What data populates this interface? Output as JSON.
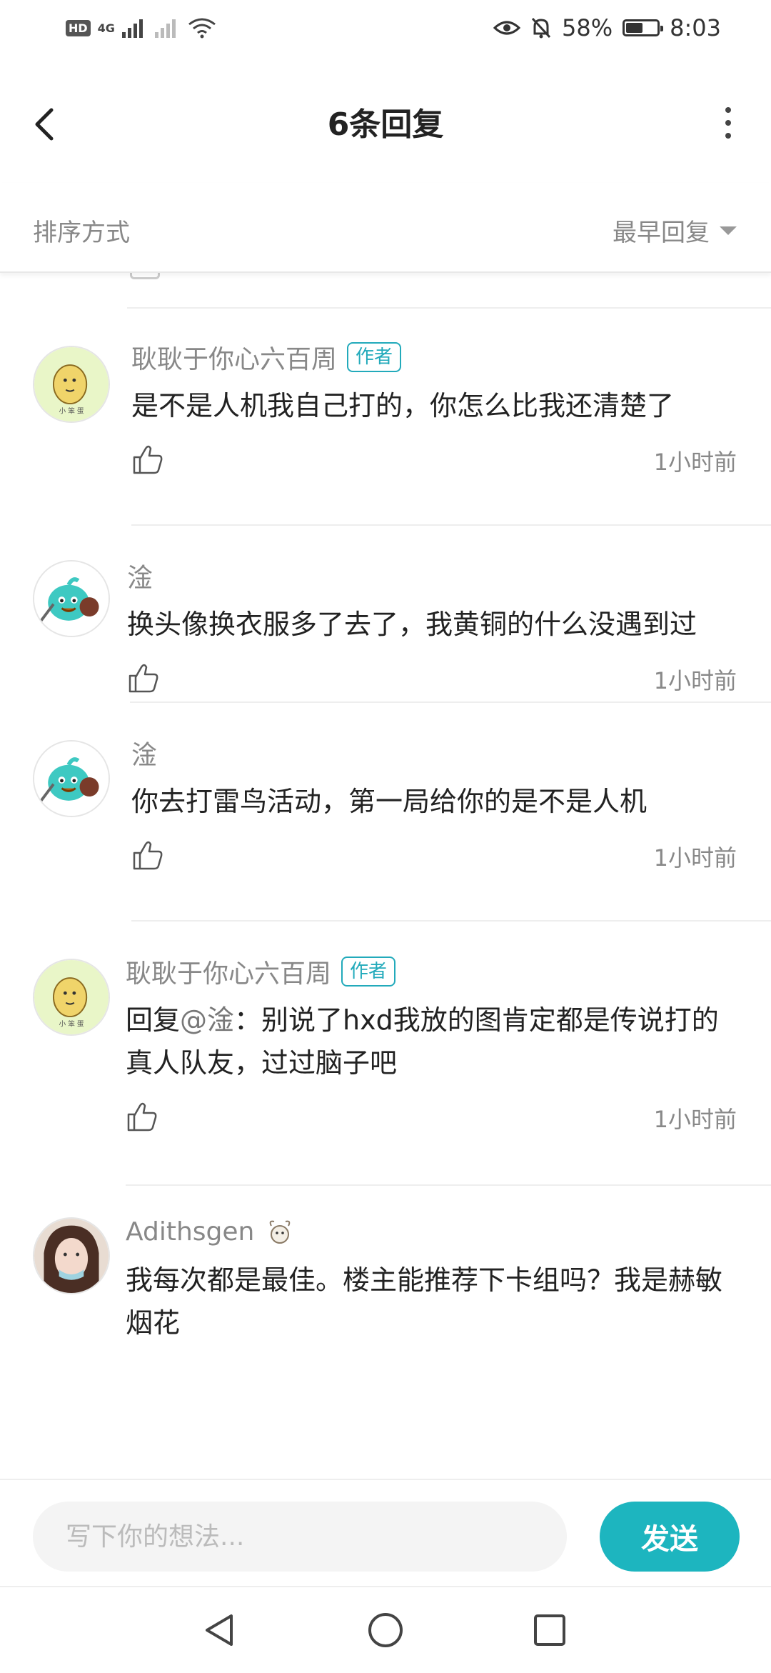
{
  "status_bar": {
    "left_badges": [
      "HD",
      "4G"
    ],
    "battery_text": "58%",
    "battery_level_percent": 58,
    "time": "8:03"
  },
  "header": {
    "title": "6条回复"
  },
  "sort": {
    "label": "排序方式",
    "selected": "最早回复"
  },
  "comments": [
    {
      "username": "耿耿于你心六百周",
      "badge": "作者",
      "text": "是不是人机我自己打的，你怎么比我还清楚了",
      "time": "1小时前",
      "avatar": "potato-avatar"
    },
    {
      "username": "淦",
      "text": "换头像换衣服多了去了，我黄铜的什么没遇到过",
      "time": "1小时前",
      "avatar": "cyan-creature-avatar"
    },
    {
      "username": "淦",
      "text": "你去打雷鸟活动，第一局给你的是不是人机",
      "time": "1小时前",
      "avatar": "cyan-creature-avatar"
    },
    {
      "username": "耿耿于你心六百周",
      "badge": "作者",
      "reply_prefix": "回复",
      "mention": "@淦",
      "text": "：别说了hxd我放的图肯定都是传说打的真人队友，过过脑子吧",
      "time": "1小时前",
      "avatar": "potato-avatar"
    },
    {
      "username": "Adithsgen",
      "text": "我每次都是最佳。楼主能推荐下卡组吗？我是赫敏烟花",
      "avatar": "user-photo-avatar"
    }
  ],
  "composer": {
    "placeholder": "写下你的想法...",
    "send_label": "发送"
  },
  "colors": {
    "accent": "#1db5bf",
    "badge": "#22aabb",
    "text_secondary": "#888888"
  }
}
